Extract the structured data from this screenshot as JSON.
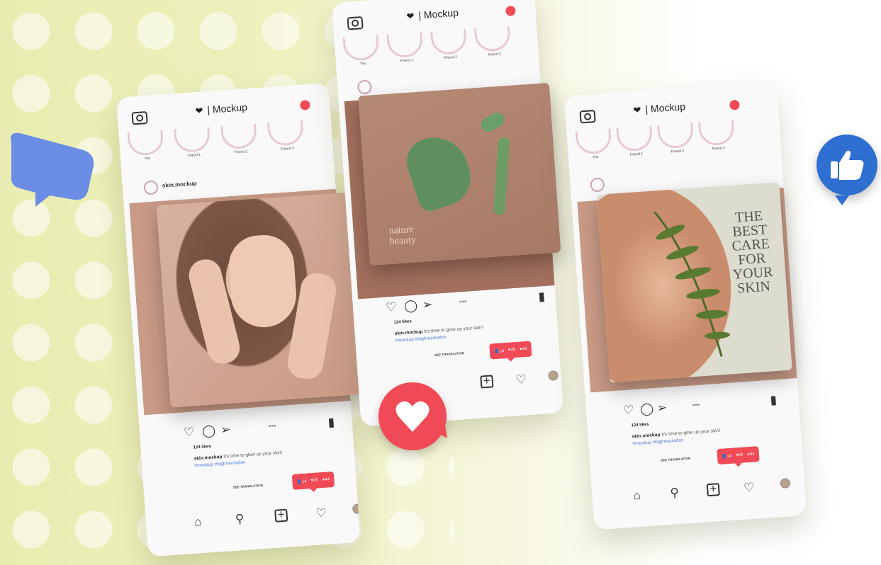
{
  "brand": {
    "name": "Mockup"
  },
  "stories": [
    "You",
    "Friend 1",
    "Friend 2",
    "Friend 3"
  ],
  "post": {
    "username": "skin.mockup",
    "likes": "124 likes",
    "caption": "It's time to glow up your skin!",
    "hashtags": "#mockup #highresolution",
    "see_translation": "SEE TRANSLATION",
    "stats": {
      "followers": "14",
      "likes": "26",
      "comments": "44"
    }
  },
  "images": {
    "middle_overlay": "nature beauty",
    "right_headline": [
      "THE",
      "BEST",
      "CARE",
      "FOR",
      "YOUR",
      "SKIN"
    ]
  },
  "colors": {
    "accent": "#ef4a55",
    "like_bubble": "#2f6fd1",
    "chat_bubble": "#6f8fe6"
  }
}
